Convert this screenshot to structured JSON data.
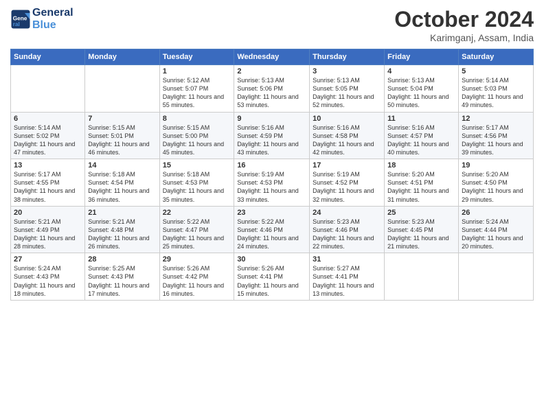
{
  "header": {
    "logo_line1": "General",
    "logo_line2": "Blue",
    "month": "October 2024",
    "location": "Karimganj, Assam, India"
  },
  "days_of_week": [
    "Sunday",
    "Monday",
    "Tuesday",
    "Wednesday",
    "Thursday",
    "Friday",
    "Saturday"
  ],
  "weeks": [
    {
      "row": 1,
      "days": [
        {
          "num": "",
          "content": ""
        },
        {
          "num": "",
          "content": ""
        },
        {
          "num": "1",
          "content": "Sunrise: 5:12 AM\nSunset: 5:07 PM\nDaylight: 11 hours and 55 minutes."
        },
        {
          "num": "2",
          "content": "Sunrise: 5:13 AM\nSunset: 5:06 PM\nDaylight: 11 hours and 53 minutes."
        },
        {
          "num": "3",
          "content": "Sunrise: 5:13 AM\nSunset: 5:05 PM\nDaylight: 11 hours and 52 minutes."
        },
        {
          "num": "4",
          "content": "Sunrise: 5:13 AM\nSunset: 5:04 PM\nDaylight: 11 hours and 50 minutes."
        },
        {
          "num": "5",
          "content": "Sunrise: 5:14 AM\nSunset: 5:03 PM\nDaylight: 11 hours and 49 minutes."
        }
      ]
    },
    {
      "row": 2,
      "days": [
        {
          "num": "6",
          "content": "Sunrise: 5:14 AM\nSunset: 5:02 PM\nDaylight: 11 hours and 47 minutes."
        },
        {
          "num": "7",
          "content": "Sunrise: 5:15 AM\nSunset: 5:01 PM\nDaylight: 11 hours and 46 minutes."
        },
        {
          "num": "8",
          "content": "Sunrise: 5:15 AM\nSunset: 5:00 PM\nDaylight: 11 hours and 45 minutes."
        },
        {
          "num": "9",
          "content": "Sunrise: 5:16 AM\nSunset: 4:59 PM\nDaylight: 11 hours and 43 minutes."
        },
        {
          "num": "10",
          "content": "Sunrise: 5:16 AM\nSunset: 4:58 PM\nDaylight: 11 hours and 42 minutes."
        },
        {
          "num": "11",
          "content": "Sunrise: 5:16 AM\nSunset: 4:57 PM\nDaylight: 11 hours and 40 minutes."
        },
        {
          "num": "12",
          "content": "Sunrise: 5:17 AM\nSunset: 4:56 PM\nDaylight: 11 hours and 39 minutes."
        }
      ]
    },
    {
      "row": 3,
      "days": [
        {
          "num": "13",
          "content": "Sunrise: 5:17 AM\nSunset: 4:55 PM\nDaylight: 11 hours and 38 minutes."
        },
        {
          "num": "14",
          "content": "Sunrise: 5:18 AM\nSunset: 4:54 PM\nDaylight: 11 hours and 36 minutes."
        },
        {
          "num": "15",
          "content": "Sunrise: 5:18 AM\nSunset: 4:53 PM\nDaylight: 11 hours and 35 minutes."
        },
        {
          "num": "16",
          "content": "Sunrise: 5:19 AM\nSunset: 4:53 PM\nDaylight: 11 hours and 33 minutes."
        },
        {
          "num": "17",
          "content": "Sunrise: 5:19 AM\nSunset: 4:52 PM\nDaylight: 11 hours and 32 minutes."
        },
        {
          "num": "18",
          "content": "Sunrise: 5:20 AM\nSunset: 4:51 PM\nDaylight: 11 hours and 31 minutes."
        },
        {
          "num": "19",
          "content": "Sunrise: 5:20 AM\nSunset: 4:50 PM\nDaylight: 11 hours and 29 minutes."
        }
      ]
    },
    {
      "row": 4,
      "days": [
        {
          "num": "20",
          "content": "Sunrise: 5:21 AM\nSunset: 4:49 PM\nDaylight: 11 hours and 28 minutes."
        },
        {
          "num": "21",
          "content": "Sunrise: 5:21 AM\nSunset: 4:48 PM\nDaylight: 11 hours and 26 minutes."
        },
        {
          "num": "22",
          "content": "Sunrise: 5:22 AM\nSunset: 4:47 PM\nDaylight: 11 hours and 25 minutes."
        },
        {
          "num": "23",
          "content": "Sunrise: 5:22 AM\nSunset: 4:46 PM\nDaylight: 11 hours and 24 minutes."
        },
        {
          "num": "24",
          "content": "Sunrise: 5:23 AM\nSunset: 4:46 PM\nDaylight: 11 hours and 22 minutes."
        },
        {
          "num": "25",
          "content": "Sunrise: 5:23 AM\nSunset: 4:45 PM\nDaylight: 11 hours and 21 minutes."
        },
        {
          "num": "26",
          "content": "Sunrise: 5:24 AM\nSunset: 4:44 PM\nDaylight: 11 hours and 20 minutes."
        }
      ]
    },
    {
      "row": 5,
      "days": [
        {
          "num": "27",
          "content": "Sunrise: 5:24 AM\nSunset: 4:43 PM\nDaylight: 11 hours and 18 minutes."
        },
        {
          "num": "28",
          "content": "Sunrise: 5:25 AM\nSunset: 4:43 PM\nDaylight: 11 hours and 17 minutes."
        },
        {
          "num": "29",
          "content": "Sunrise: 5:26 AM\nSunset: 4:42 PM\nDaylight: 11 hours and 16 minutes."
        },
        {
          "num": "30",
          "content": "Sunrise: 5:26 AM\nSunset: 4:41 PM\nDaylight: 11 hours and 15 minutes."
        },
        {
          "num": "31",
          "content": "Sunrise: 5:27 AM\nSunset: 4:41 PM\nDaylight: 11 hours and 13 minutes."
        },
        {
          "num": "",
          "content": ""
        },
        {
          "num": "",
          "content": ""
        }
      ]
    }
  ]
}
